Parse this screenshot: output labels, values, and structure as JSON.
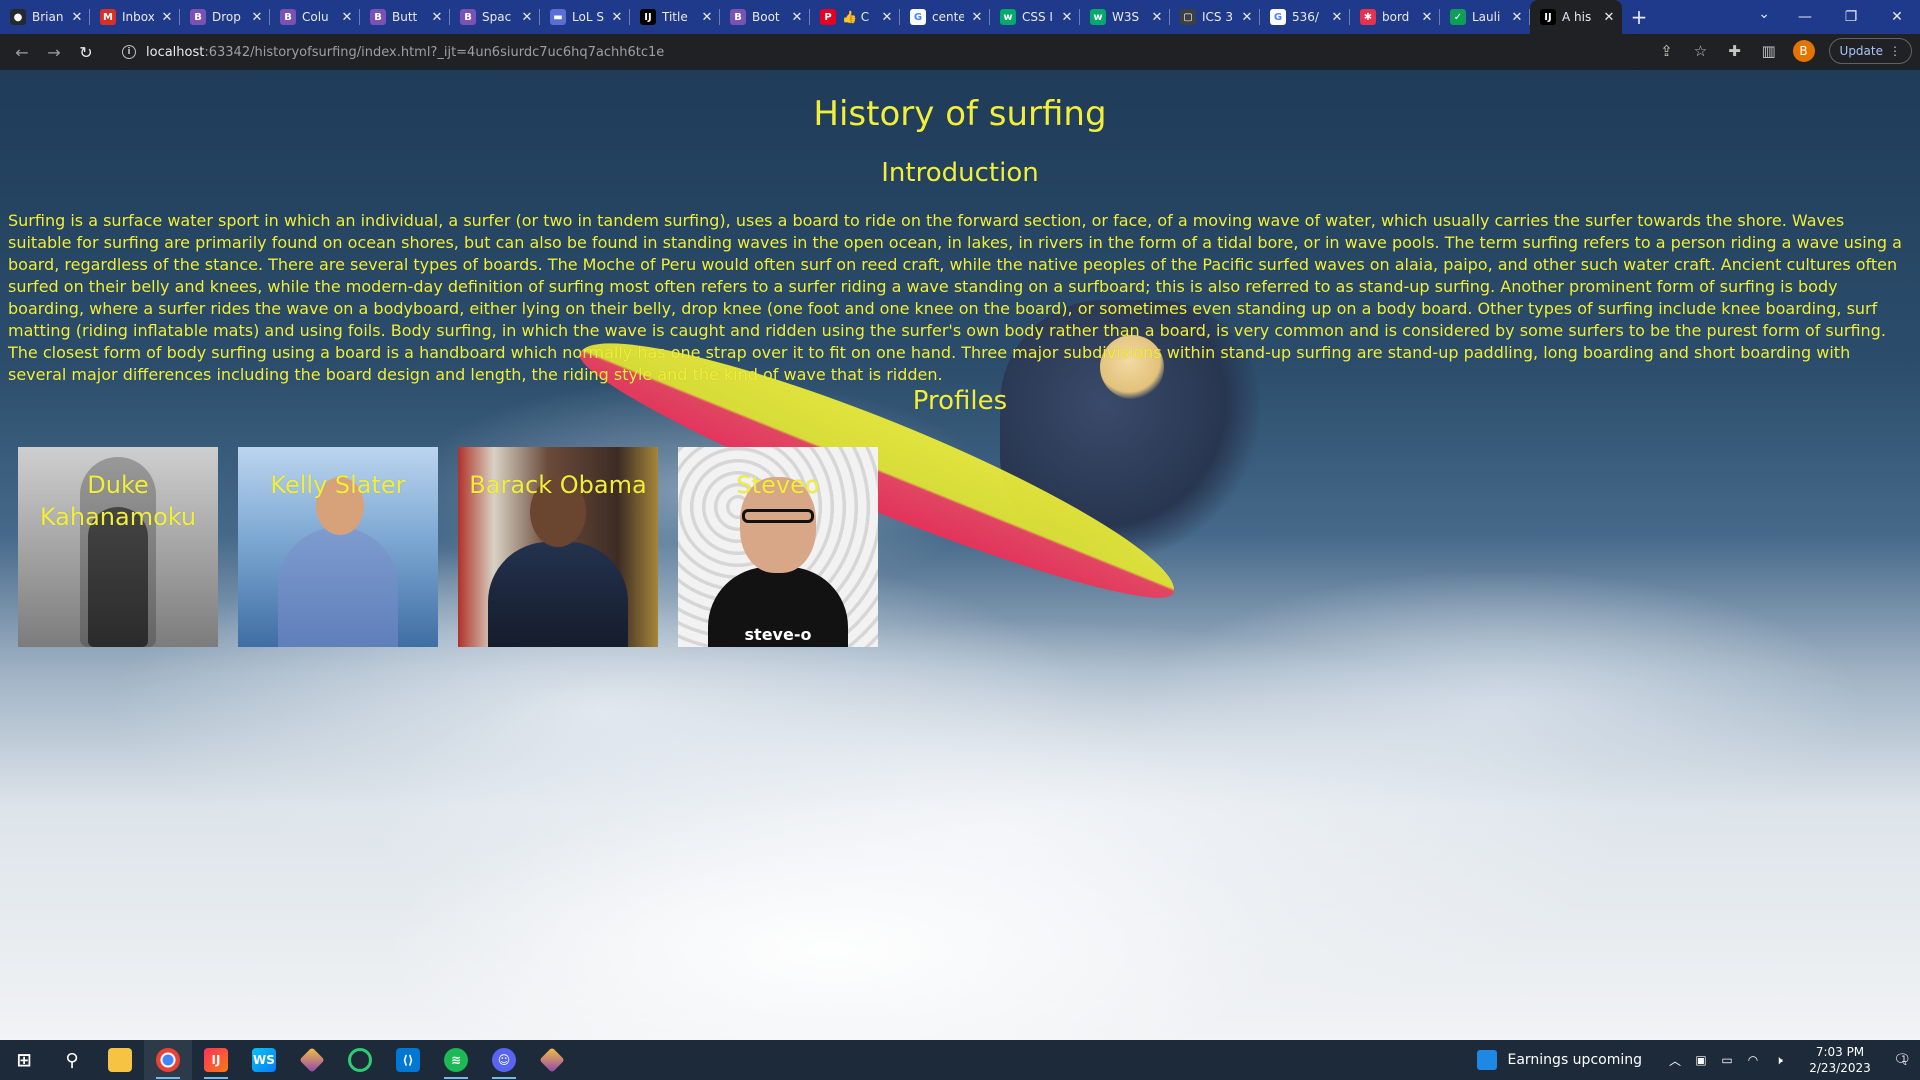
{
  "browser": {
    "tabs": [
      {
        "title": "Brian",
        "icon": "github-icon",
        "color": "#24292f",
        "glyph": "●"
      },
      {
        "title": "Inbox",
        "icon": "gmail-icon",
        "color": "#d93025",
        "glyph": "M"
      },
      {
        "title": "Drop",
        "icon": "bootstrap-icon",
        "color": "#7952b3",
        "glyph": "B"
      },
      {
        "title": "Colu",
        "icon": "bootstrap-icon",
        "color": "#7952b3",
        "glyph": "B"
      },
      {
        "title": "Butt",
        "icon": "bootstrap-icon",
        "color": "#7952b3",
        "glyph": "B"
      },
      {
        "title": "Spac",
        "icon": "bootstrap-icon",
        "color": "#7952b3",
        "glyph": "B"
      },
      {
        "title": "LoL S",
        "icon": "lol-icon",
        "color": "#5a6fd6",
        "glyph": "▬"
      },
      {
        "title": "Title",
        "icon": "intellij-icon",
        "color": "#000000",
        "glyph": "IJ"
      },
      {
        "title": "Boot",
        "icon": "bootstrap-icon",
        "color": "#7952b3",
        "glyph": "B"
      },
      {
        "title": "👍 C",
        "icon": "pinterest-icon",
        "color": "#e60023",
        "glyph": "P"
      },
      {
        "title": "cente",
        "icon": "google-icon",
        "color": "#ffffff",
        "glyph": "G"
      },
      {
        "title": "CSS I",
        "icon": "w3schools-icon",
        "color": "#04aa6d",
        "glyph": "w"
      },
      {
        "title": "W3S",
        "icon": "w3schools-icon",
        "color": "#04aa6d",
        "glyph": "w"
      },
      {
        "title": "ICS 3",
        "icon": "doc-icon",
        "color": "#3c4043",
        "glyph": "▢"
      },
      {
        "title": "536/",
        "icon": "google-icon",
        "color": "#ffffff",
        "glyph": "G"
      },
      {
        "title": "bord",
        "icon": "asterisk-icon",
        "color": "#e8304f",
        "glyph": "✱"
      },
      {
        "title": "Lauli",
        "icon": "check-icon",
        "color": "#0f9d58",
        "glyph": "✓"
      },
      {
        "title": "A his",
        "icon": "intellij-icon",
        "color": "#000000",
        "glyph": "IJ",
        "active": true
      }
    ],
    "new_tab": "+",
    "url_host": "localhost",
    "url_rest": ":63342/historyofsurfing/index.html?_ijt=4un6siurdc7uc6hq7achh6tc1e",
    "profile_initial": "B",
    "update_label": "Update"
  },
  "page": {
    "title": "History of surfing",
    "intro_heading": "Introduction",
    "intro_text": "Surfing is a surface water sport in which an individual, a surfer (or two in tandem surfing), uses a board to ride on the forward section, or face, of a moving wave of water, which usually carries the surfer towards the shore. Waves suitable for surfing are primarily found on ocean shores, but can also be found in standing waves in the open ocean, in lakes, in rivers in the form of a tidal bore, or in wave pools. The term surfing refers to a person riding a wave using a board, regardless of the stance. There are several types of boards. The Moche of Peru would often surf on reed craft, while the native peoples of the Pacific surfed waves on alaia, paipo, and other such water craft. Ancient cultures often surfed on their belly and knees, while the modern-day definition of surfing most often refers to a surfer riding a wave standing on a surfboard; this is also referred to as stand-up surfing. Another prominent form of surfing is body boarding, where a surfer rides the wave on a bodyboard, either lying on their belly, drop knee (one foot and one knee on the board), or sometimes even standing up on a body board. Other types of surfing include knee boarding, surf matting (riding inflatable mats) and using foils. Body surfing, in which the wave is caught and ridden using the surfer's own body rather than a board, is very common and is considered by some surfers to be the purest form of surfing. The closest form of body surfing using a board is a handboard which normally has one strap over it to fit on one hand. Three major subdivisions within stand-up surfing are stand-up paddling, long boarding and short boarding with several major differences including the board design and length, the riding style and the kind of wave that is ridden.",
    "profiles_heading": "Profiles",
    "profiles": [
      {
        "name": "Duke Kahanamoku"
      },
      {
        "name": "Kelly Slater"
      },
      {
        "name": "Barack Obama"
      },
      {
        "name": "Steveo",
        "shirt_text": "steve-o"
      }
    ]
  },
  "taskbar": {
    "news_text": "Earnings upcoming",
    "time": "7:03 PM",
    "date": "2/23/2023",
    "notification_count": "1"
  }
}
